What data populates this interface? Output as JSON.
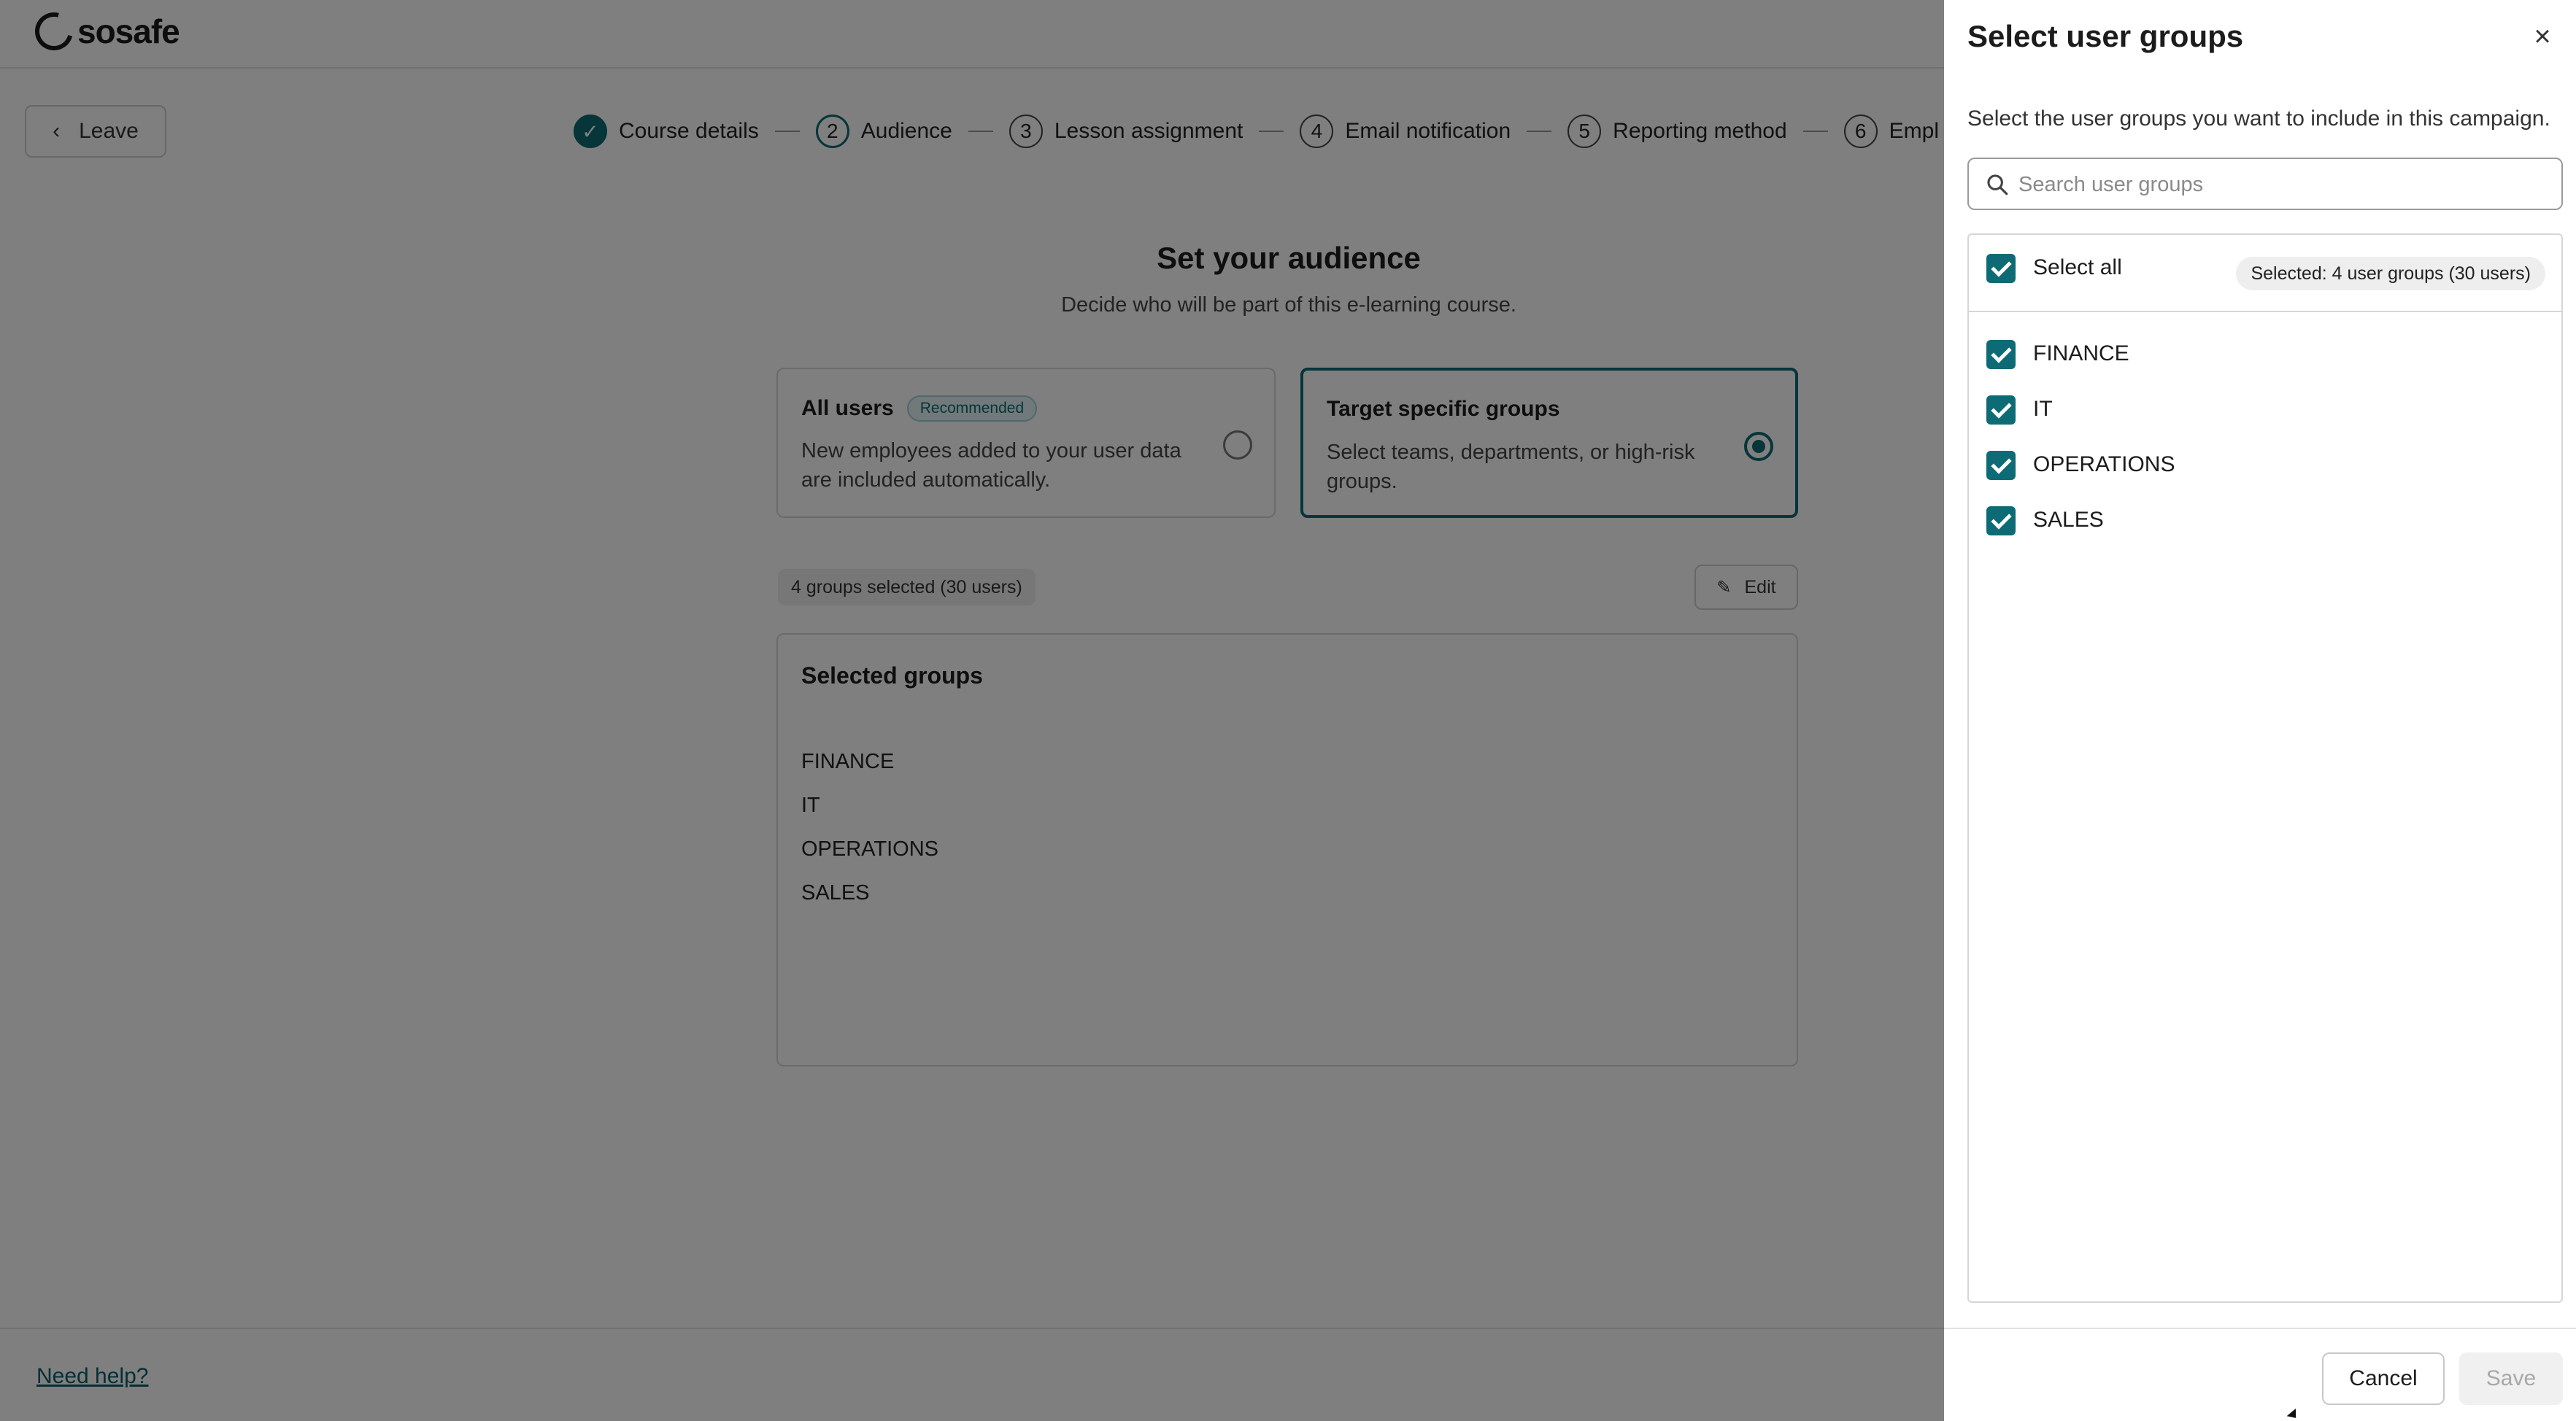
{
  "header": {
    "logo_text": "sosafe"
  },
  "nav": {
    "leave_label": "Leave"
  },
  "stepper": {
    "steps": [
      {
        "number": "",
        "label": "Course details",
        "state": "done"
      },
      {
        "number": "2",
        "label": "Audience",
        "state": "active"
      },
      {
        "number": "3",
        "label": "Lesson assignment",
        "state": "todo"
      },
      {
        "number": "4",
        "label": "Email notification",
        "state": "todo"
      },
      {
        "number": "5",
        "label": "Reporting method",
        "state": "todo"
      },
      {
        "number": "6",
        "label": "Empl",
        "state": "todo"
      }
    ]
  },
  "audience": {
    "title": "Set your audience",
    "subtitle": "Decide who will be part of this e-learning course.",
    "options": [
      {
        "title": "All users",
        "badge": "Recommended",
        "description": "New employees added to your user data are included automatically.",
        "selected": false
      },
      {
        "title": "Target specific groups",
        "description": "Select teams, departments, or high-risk groups.",
        "selected": true
      }
    ],
    "groups_selected_text": "4 groups selected (30 users)",
    "edit_label": "Edit",
    "selected_groups_title": "Selected groups",
    "selected_groups": [
      "FINANCE",
      "IT",
      "OPERATIONS",
      "SALES"
    ]
  },
  "footer": {
    "help_label": "Need help?"
  },
  "drawer": {
    "title": "Select user groups",
    "description": "Select the user groups you want to include in this campaign.",
    "search_placeholder": "Search user groups",
    "select_all_label": "Select all",
    "selected_count_text": "Selected: 4 user groups (30 users)",
    "groups": [
      {
        "label": "FINANCE",
        "checked": true
      },
      {
        "label": "IT",
        "checked": true
      },
      {
        "label": "OPERATIONS",
        "checked": true
      },
      {
        "label": "SALES",
        "checked": true
      }
    ],
    "cancel_label": "Cancel",
    "save_label": "Save"
  },
  "colors": {
    "accent": "#0d6b75",
    "overlay": "#808080"
  }
}
